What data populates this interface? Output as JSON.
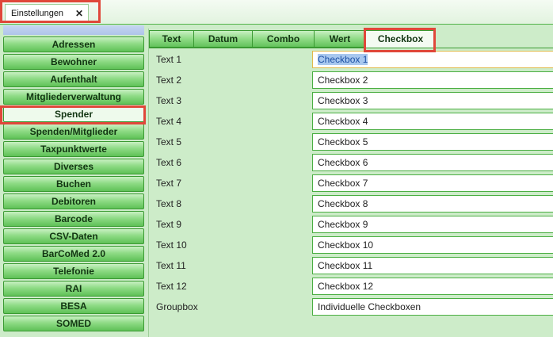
{
  "window": {
    "tab_label": "Einstellungen",
    "close_glyph": "✕"
  },
  "sidebar": {
    "items": [
      {
        "label": "Adressen"
      },
      {
        "label": "Bewohner"
      },
      {
        "label": "Aufenthalt"
      },
      {
        "label": "Mitgliederverwaltung"
      },
      {
        "label": "Spender",
        "active": true
      },
      {
        "label": "Spenden/Mitglieder"
      },
      {
        "label": "Taxpunktwerte"
      },
      {
        "label": "Diverses"
      },
      {
        "label": "Buchen"
      },
      {
        "label": "Debitoren"
      },
      {
        "label": "Barcode"
      },
      {
        "label": "CSV-Daten"
      },
      {
        "label": "BarCoMed 2.0"
      },
      {
        "label": "Telefonie"
      },
      {
        "label": "RAI"
      },
      {
        "label": "BESA"
      },
      {
        "label": "SOMED"
      }
    ]
  },
  "tabs": [
    {
      "label": "Text"
    },
    {
      "label": "Datum"
    },
    {
      "label": "Combo"
    },
    {
      "label": "Wert"
    },
    {
      "label": "Checkbox",
      "active": true
    }
  ],
  "form": {
    "rows": [
      {
        "label": "Text 1",
        "value": "Checkbox 1",
        "focused": true
      },
      {
        "label": "Text 2",
        "value": "Checkbox 2"
      },
      {
        "label": "Text 3",
        "value": "Checkbox 3"
      },
      {
        "label": "Text 4",
        "value": "Checkbox 4"
      },
      {
        "label": "Text 5",
        "value": "Checkbox 5"
      },
      {
        "label": "Text 6",
        "value": "Checkbox 6"
      },
      {
        "label": "Text 7",
        "value": "Checkbox 7"
      },
      {
        "label": "Text 8",
        "value": "Checkbox 8"
      },
      {
        "label": "Text 9",
        "value": "Checkbox 9"
      },
      {
        "label": "Text 10",
        "value": "Checkbox 10"
      },
      {
        "label": "Text 11",
        "value": "Checkbox 11"
      },
      {
        "label": "Text 12",
        "value": "Checkbox 12"
      },
      {
        "label": "Groupbox",
        "value": "Individuelle Checkboxen"
      }
    ]
  },
  "colors": {
    "background": "#cdecc9",
    "accent_green": "#3a9a32",
    "highlight_red": "#e0473a",
    "selection": "#a8c8ef"
  }
}
